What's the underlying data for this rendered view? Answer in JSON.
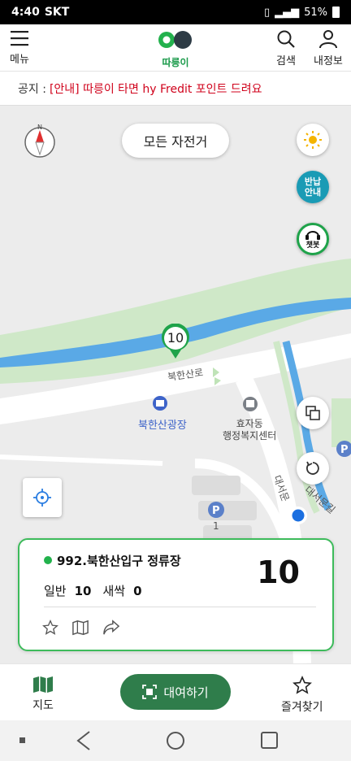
{
  "status": {
    "time": "4:40",
    "carrier": "SKT",
    "battery": "51%"
  },
  "header": {
    "menu_label": "메뉴",
    "logo_text": "따릉이",
    "search_label": "검색",
    "my_label": "내정보"
  },
  "notice": {
    "label": "공지 :",
    "message": "[안내] 따릉이 타면 hy Fredit 포인트 드려요"
  },
  "map": {
    "all_bikes_button": "모든 자전거",
    "pet_button": "반납\n안내",
    "chatbot_label": "챗봇",
    "pin_count": "10",
    "labels": {
      "road": "북한산로",
      "plaza": "북한산광장",
      "center": "효자동\n행정복지센터",
      "road2": "대서문길",
      "road3": "대서문",
      "parking_num": "1"
    }
  },
  "station_card": {
    "name": "992.북한산입구 정류장",
    "general_label": "일반",
    "general_count": "10",
    "sprout_label": "새싹",
    "sprout_count": "0",
    "total": "10"
  },
  "tabbar": {
    "map_label": "지도",
    "rent_label": "대여하기",
    "favorite_label": "즐겨찾기"
  },
  "colors": {
    "brand_green": "#1fa34a",
    "rent_button": "#2f7d4b",
    "notice_red": "#d0021b",
    "river": "#5aa9e6",
    "park": "#cfe8c8"
  }
}
